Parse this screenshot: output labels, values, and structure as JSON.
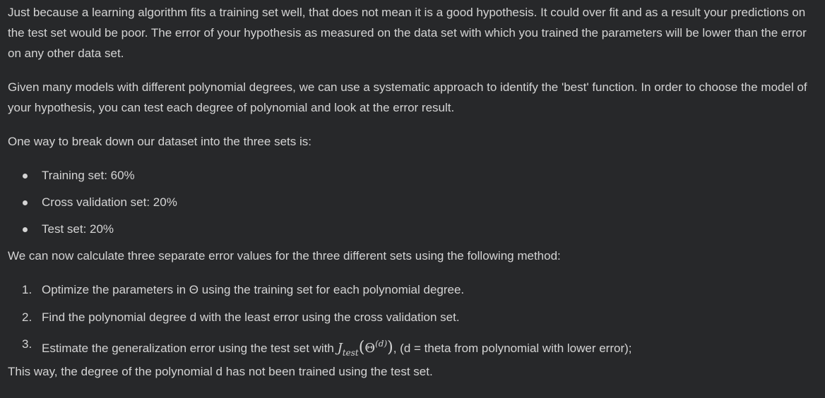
{
  "paragraphs": {
    "p1": "Just because a learning algorithm fits a training set well, that does not mean it is a good hypothesis. It could over fit and as a result your predictions on the test set would be poor. The error of your hypothesis as measured on the data set with which you trained the parameters will be lower than the error on any other data set.",
    "p2": "Given many models with different polynomial degrees, we can use a systematic approach to identify the 'best' function. In order to choose the model of your hypothesis, you can test each degree of polynomial and look at the error result.",
    "p3": "One way to break down our dataset into the three sets is:",
    "p4": "We can now calculate three separate error values for the three different sets using the following method:",
    "p5": "This way, the degree of the polynomial d has not been trained using the test set."
  },
  "bullets": [
    "Training set: 60%",
    "Cross validation set: 20%",
    "Test set: 20%"
  ],
  "steps": {
    "s1_num": "1.",
    "s1": "Optimize the parameters in Θ using the training set for each polynomial degree.",
    "s2_num": "2.",
    "s2": "Find the polynomial degree d with the least error using the cross validation set.",
    "s3_num": "3.",
    "s3_pre": "Estimate the generalization error using the test set with ",
    "s3_math_J": "J",
    "s3_math_sub": "test",
    "s3_math_open": "(",
    "s3_math_theta": "Θ",
    "s3_math_sup": "(d)",
    "s3_math_close": ")",
    "s3_post": ", (d = theta from polynomial with lower error);"
  }
}
